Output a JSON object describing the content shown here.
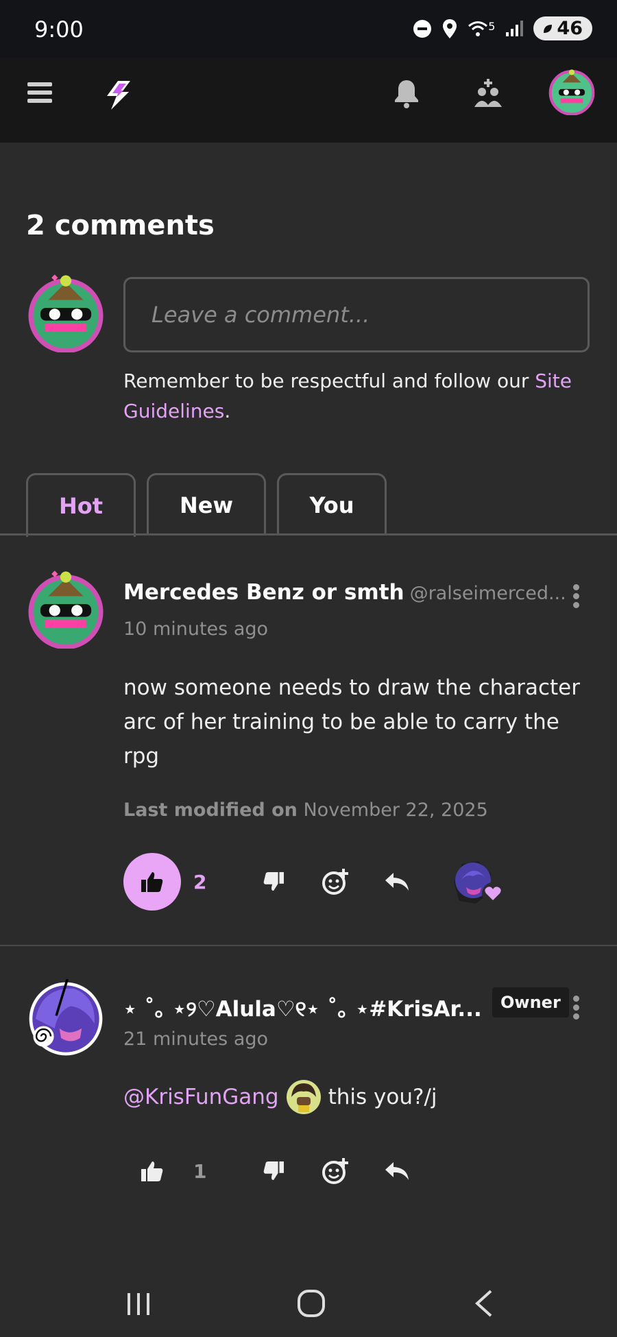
{
  "status": {
    "time": "9:00",
    "battery": "46",
    "wifi_level": "5"
  },
  "appbar": {
    "menu_icon": "hamburger-icon",
    "logo_icon": "lightning-logo",
    "notifications_icon": "bell-icon",
    "friends_icon": "people-icon",
    "profile_icon": "avatar"
  },
  "comments": {
    "title": "2 comments",
    "input_placeholder": "Leave a comment...",
    "guidelines_text": "Remember to be respectful and follow our ",
    "guidelines_link": "Site Guidelines",
    "guidelines_end": "."
  },
  "tabs": [
    {
      "label": "Hot",
      "active": true
    },
    {
      "label": "New",
      "active": false
    },
    {
      "label": "You",
      "active": false
    }
  ],
  "comment_list": [
    {
      "author": "Mercedes Benz or smth",
      "handle": "@ralseimerced...",
      "time": "10 minutes ago",
      "body": "now someone needs to draw the character arc of her training to be able to carry the rpg",
      "modified_label": "Last modified on",
      "modified_date": "November 22, 2025",
      "likes": "2",
      "liked": true
    },
    {
      "author": "⋆ ˚｡ ⋆୨♡Alula♡୧⋆ ˚｡ ⋆#KrisAr...",
      "badge": "Owner",
      "time": "21 minutes ago",
      "mention": "@KrisFunGang",
      "body_after": " this you?/j",
      "likes": "1",
      "liked": false
    }
  ],
  "colors": {
    "accent": "#e2a3f5",
    "like_bg": "#e9a6f7",
    "background": "#2b2b2b",
    "appbar": "#171717"
  },
  "navbar": {
    "recents_icon": "recents-icon",
    "home_icon": "home-icon",
    "back_icon": "back-icon"
  }
}
